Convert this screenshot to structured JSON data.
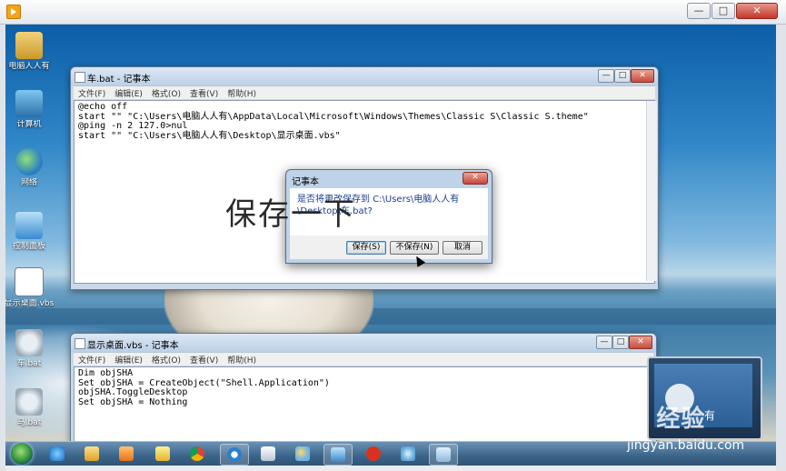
{
  "window_controls": {
    "minimize": "—",
    "maximize": "□",
    "close": "✕"
  },
  "desktop_icons": [
    {
      "label": "电脑人人有",
      "icon": "user-folder-icon"
    },
    {
      "label": "计算机",
      "icon": "computer-icon"
    },
    {
      "label": "网络",
      "icon": "network-globe-icon"
    },
    {
      "label": "控制面板",
      "icon": "control-panel-icon"
    },
    {
      "label": "显示桌面.vbs",
      "icon": "vbs-script-icon"
    },
    {
      "label": "车.bat",
      "icon": "bat-gear-icon"
    },
    {
      "label": "马.bat",
      "icon": "bat-gear-icon"
    }
  ],
  "notepad1": {
    "title": "车.bat - 记事本",
    "menu": [
      "文件(F)",
      "编辑(E)",
      "格式(O)",
      "查看(V)",
      "帮助(H)"
    ],
    "lines": [
      "@echo off",
      "start \"\" \"C:\\Users\\电脑人人有\\AppData\\Local\\Microsoft\\Windows\\Themes\\Classic S\\Classic S.theme\"",
      "@ping -n 2 127.0>nul",
      "start \"\" \"C:\\Users\\电脑人人有\\Desktop\\显示桌面.vbs\""
    ]
  },
  "notepad2": {
    "title": "显示桌面.vbs - 记事本",
    "menu": [
      "文件(F)",
      "编辑(E)",
      "格式(O)",
      "查看(V)",
      "帮助(H)"
    ],
    "lines": [
      "Dim objSHA",
      "Set objSHA = CreateObject(\"Shell.Application\")",
      "objSHA.ToggleDesktop",
      "Set objSHA = Nothing"
    ]
  },
  "dialog": {
    "title": "记事本",
    "message": "是否将更改保存到 C:\\Users\\电脑人人有\\Desktop\\车.bat?",
    "save_label": "保存(S)",
    "dont_save_label": "不保存(N)",
    "cancel_label": "取消"
  },
  "overlay_text": "保存一下",
  "taskbar_icons": [
    "start-orb-icon",
    "ie-icon",
    "explorer-folder-icon",
    "media-player-icon",
    "folder-icon",
    "chrome-icon",
    "video-app-icon",
    "file-icon",
    "paint-icon",
    "remote-desktop-icon",
    "red-badge-icon",
    "game-icon",
    "notepad-icon"
  ],
  "watermark": {
    "brand": "Bai 经验",
    "laptop_text": "有",
    "url": "jingyan.baidu.com"
  }
}
